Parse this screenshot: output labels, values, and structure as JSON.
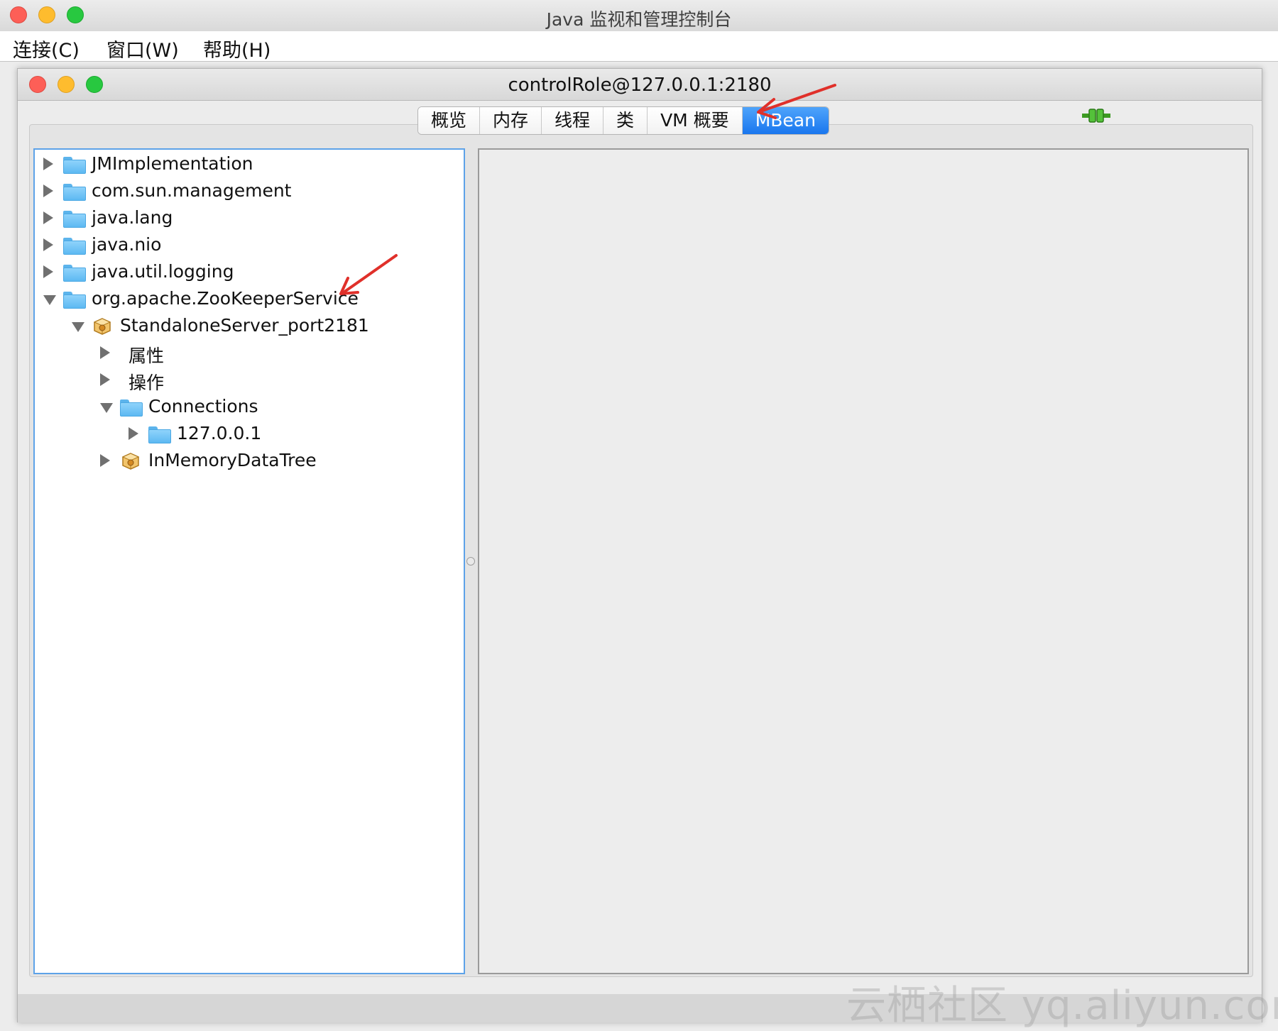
{
  "app": {
    "title": "Java 监视和管理控制台"
  },
  "menu": {
    "items": [
      "连接(C)",
      "窗口(W)",
      "帮助(H)"
    ]
  },
  "window": {
    "title": "controlRole@127.0.0.1:2180"
  },
  "tabs": [
    {
      "label": "概览",
      "active": false
    },
    {
      "label": "内存",
      "active": false
    },
    {
      "label": "线程",
      "active": false
    },
    {
      "label": "类",
      "active": false
    },
    {
      "label": "VM 概要",
      "active": false
    },
    {
      "label": "MBean",
      "active": true
    }
  ],
  "tree": [
    {
      "label": "JMImplementation",
      "icon": "folder-icon",
      "state": "collapsed",
      "depth": 0
    },
    {
      "label": "com.sun.management",
      "icon": "folder-icon",
      "state": "collapsed",
      "depth": 0
    },
    {
      "label": "java.lang",
      "icon": "folder-icon",
      "state": "collapsed",
      "depth": 0
    },
    {
      "label": "java.nio",
      "icon": "folder-icon",
      "state": "collapsed",
      "depth": 0
    },
    {
      "label": "java.util.logging",
      "icon": "folder-icon",
      "state": "collapsed",
      "depth": 0
    },
    {
      "label": "org.apache.ZooKeeperService",
      "icon": "folder-icon",
      "state": "expanded",
      "depth": 0
    },
    {
      "label": "StandaloneServer_port2181",
      "icon": "mbean-icon",
      "state": "expanded",
      "depth": 1
    },
    {
      "label": "属性",
      "icon": "",
      "state": "collapsed",
      "depth": 2
    },
    {
      "label": "操作",
      "icon": "",
      "state": "collapsed",
      "depth": 2
    },
    {
      "label": "Connections",
      "icon": "folder-icon",
      "state": "expanded",
      "depth": 2
    },
    {
      "label": "127.0.0.1",
      "icon": "folder-icon",
      "state": "collapsed",
      "depth": 3
    },
    {
      "label": "InMemoryDataTree",
      "icon": "mbean-icon",
      "state": "collapsed",
      "depth": 2
    }
  ],
  "watermark": "云栖社区 yq.aliyun.com",
  "colors": {
    "accent": "#1976ee",
    "annotation_arrow": "#e0302a",
    "tree_border": "#5da2e8"
  }
}
